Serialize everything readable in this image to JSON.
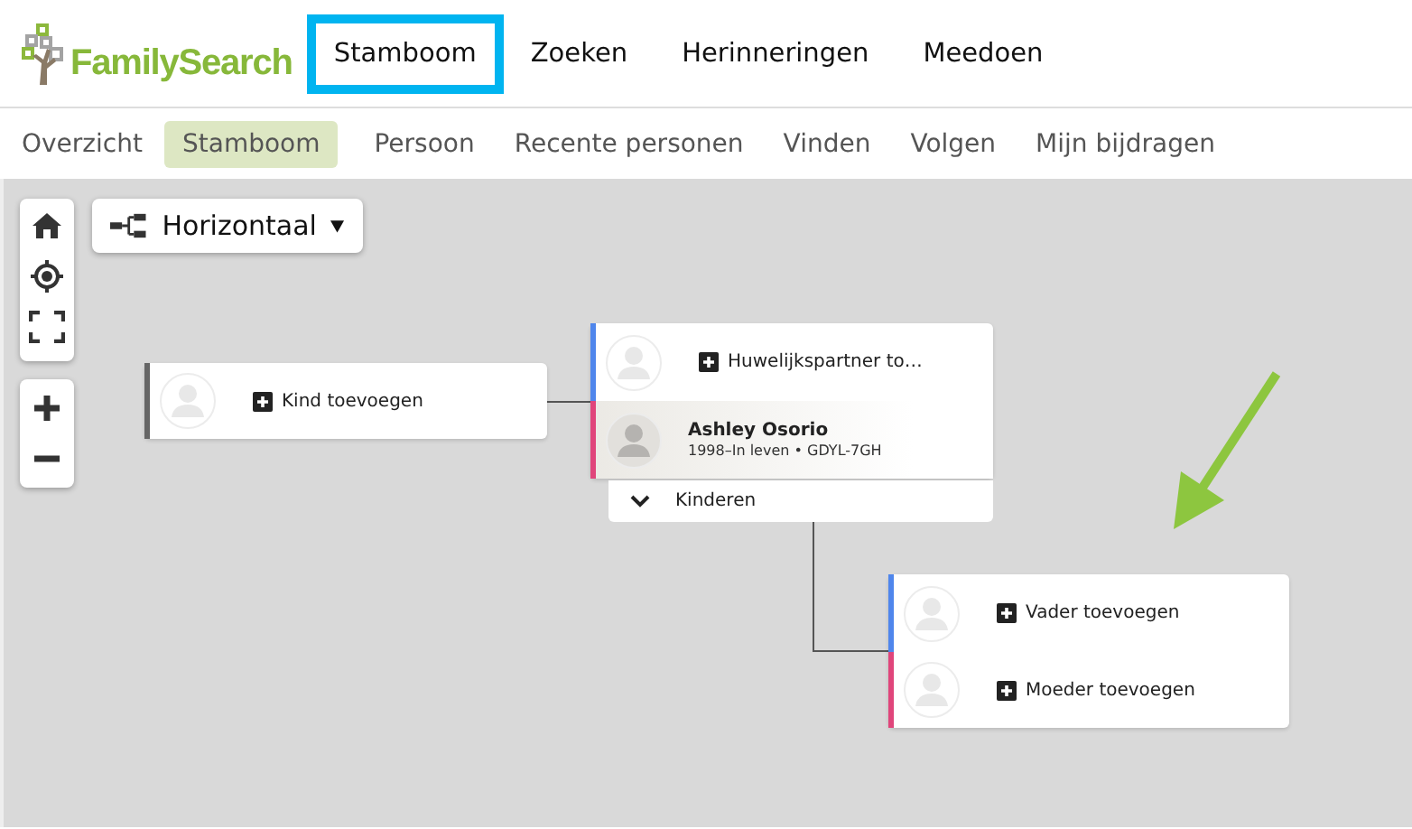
{
  "logo": {
    "text": "FamilySearch"
  },
  "top_nav": [
    {
      "label": "Stamboom",
      "highlighted": true
    },
    {
      "label": "Zoeken",
      "highlighted": false
    },
    {
      "label": "Herinneringen",
      "highlighted": false
    },
    {
      "label": "Meedoen",
      "highlighted": false
    }
  ],
  "sub_nav": [
    {
      "label": "Overzicht",
      "selected": false
    },
    {
      "label": "Stamboom",
      "selected": true
    },
    {
      "label": "Persoon",
      "selected": false
    },
    {
      "label": "Recente personen",
      "selected": false
    },
    {
      "label": "Vinden",
      "selected": false
    },
    {
      "label": "Volgen",
      "selected": false
    },
    {
      "label": "Mijn bijdragen",
      "selected": false
    }
  ],
  "view_dropdown": {
    "label": "Horizontaal"
  },
  "tree": {
    "child_card": {
      "action": "Kind toevoegen",
      "color": "#666666"
    },
    "couple": {
      "spouse": {
        "action": "Huwelijkspartner to…",
        "color": "#4f86ec"
      },
      "person": {
        "name": "Ashley Osorio",
        "details": "1998–In leven • GDYL-7GH",
        "color": "#e0457b"
      },
      "children_toggle": {
        "label": "Kinderen"
      }
    },
    "parents": [
      {
        "action": "Vader toevoegen",
        "color": "#4f86ec"
      },
      {
        "action": "Moeder toevoegen",
        "color": "#e0457b"
      }
    ]
  }
}
